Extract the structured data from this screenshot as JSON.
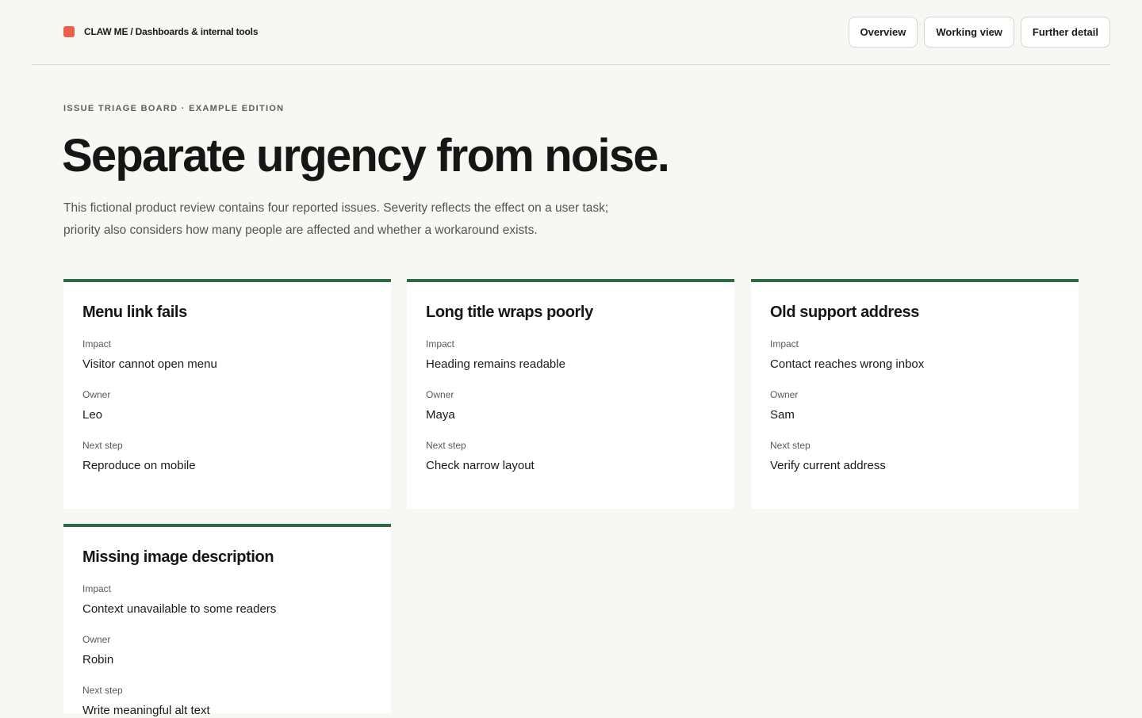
{
  "header": {
    "brand": "CLAW ME / Dashboards & internal tools",
    "brand_color": "#ea6049",
    "nav": [
      {
        "label": "Overview"
      },
      {
        "label": "Working view"
      },
      {
        "label": "Further detail"
      }
    ]
  },
  "hero": {
    "eyebrow": "ISSUE TRIAGE BOARD · EXAMPLE EDITION",
    "title": "Separate urgency from noise.",
    "intro": "This fictional product review contains four reported issues. Severity reflects the effect on a user task; priority also considers how many people are affected and whether a workaround exists."
  },
  "labels": {
    "impact": "Impact",
    "owner": "Owner",
    "next_step": "Next step"
  },
  "accent_color": "#2d6a45",
  "issues": [
    {
      "title": "Menu link fails",
      "impact": "Visitor cannot open menu",
      "owner": "Leo",
      "next_step": "Reproduce on mobile"
    },
    {
      "title": "Long title wraps poorly",
      "impact": "Heading remains readable",
      "owner": "Maya",
      "next_step": "Check narrow layout"
    },
    {
      "title": "Old support address",
      "impact": "Contact reaches wrong inbox",
      "owner": "Sam",
      "next_step": "Verify current address"
    },
    {
      "title": "Missing image description",
      "impact": "Context unavailable to some readers",
      "owner": "Robin",
      "next_step": "Write meaningful alt text"
    }
  ]
}
